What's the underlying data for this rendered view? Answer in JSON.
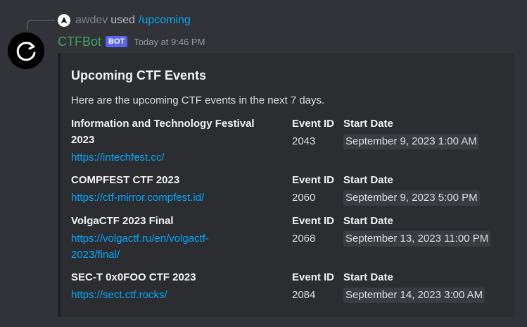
{
  "reply": {
    "username": "awdev",
    "used_text": "used",
    "command": "/upcoming"
  },
  "author": {
    "name": "CTFBot",
    "tag": "BOT",
    "timestamp": "Today at 9:46 PM"
  },
  "embed": {
    "title": "Upcoming CTF Events",
    "description": "Here are the upcoming CTF events in the next 7 days.",
    "event_id_label": "Event ID",
    "start_date_label": "Start Date",
    "events": [
      {
        "name_line1": "Information and Technology Festival",
        "name_line2": "2023",
        "url": "https://intechfest.cc/",
        "event_id": "2043",
        "start_date": "September 9, 2023 1:00 AM"
      },
      {
        "name_line1": "COMPFEST CTF 2023",
        "url": "https://ctf-mirror.compfest.id/",
        "event_id": "2060",
        "start_date": "September 9, 2023 5:00 PM"
      },
      {
        "name_line1": "VolgaCTF 2023 Final",
        "url_line1": "https://volgactf.ru/en/volgactf-",
        "url_line2": "2023/final/",
        "event_id": "2068",
        "start_date": "September 13, 2023 11:00 PM"
      },
      {
        "name_line1": "SEC-T 0x0FOO CTF 2023",
        "url": "https://sect.ctf.rocks/",
        "event_id": "2084",
        "start_date": "September 14, 2023 3:00 AM"
      }
    ]
  },
  "colors": {
    "background": "#313338",
    "embed_background": "#2b2d31",
    "link": "#00a8fc",
    "bot_name": "#3ba55c",
    "bot_tag": "#5865f2"
  },
  "icons": {
    "reply_avatar": "navigation-arrow-icon",
    "bot_avatar": "circular-arrow-icon"
  }
}
